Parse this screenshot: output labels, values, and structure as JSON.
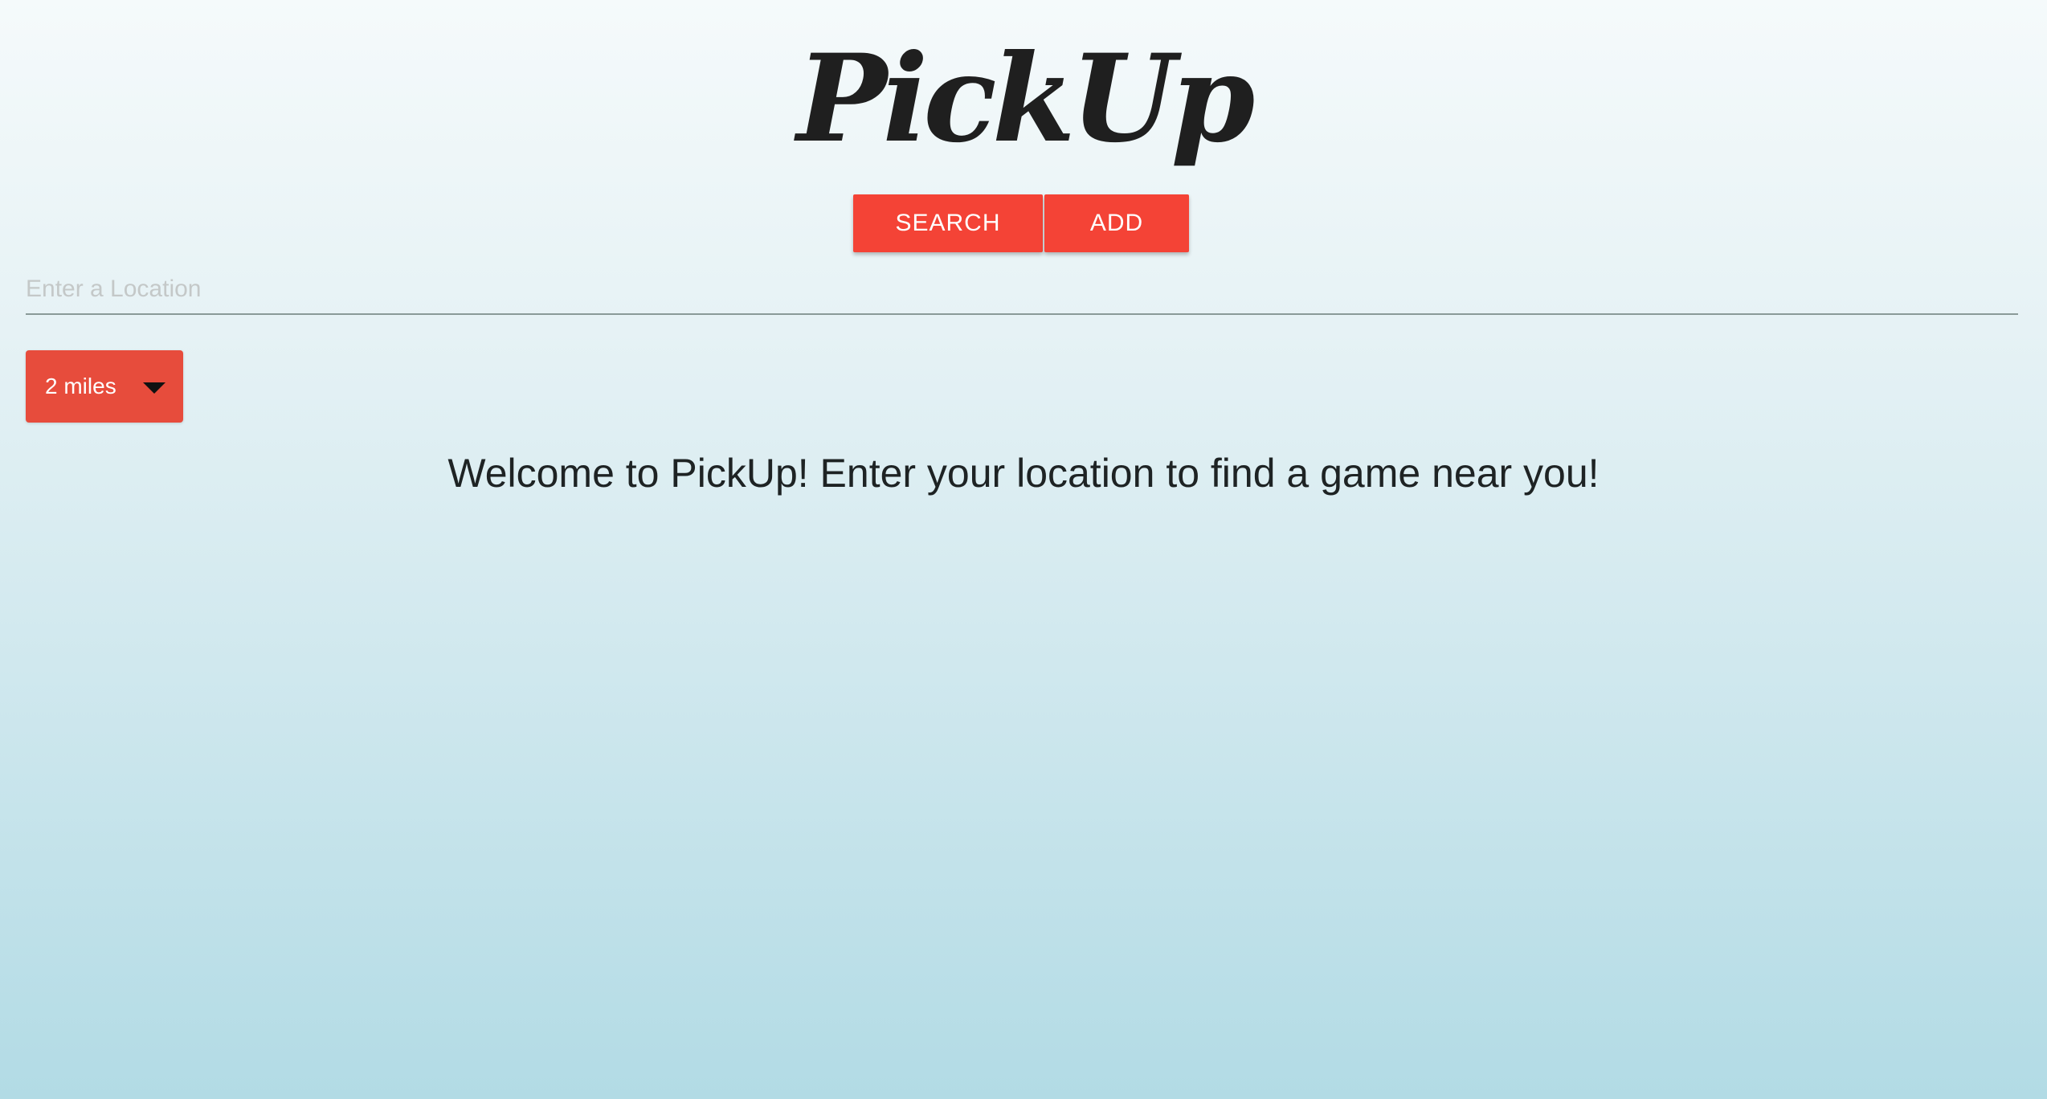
{
  "header": {
    "logo_text": "PickUp"
  },
  "nav": {
    "search_label": "SEARCH",
    "add_label": "ADD"
  },
  "location": {
    "placeholder": "Enter a Location",
    "value": ""
  },
  "distance": {
    "selected": "2 miles"
  },
  "main": {
    "welcome_text": "Welcome to PickUp! Enter your location to find a game near you!"
  },
  "colors": {
    "accent": "#f44336",
    "dropdown": "#e74c3c",
    "text": "#1e2324"
  }
}
